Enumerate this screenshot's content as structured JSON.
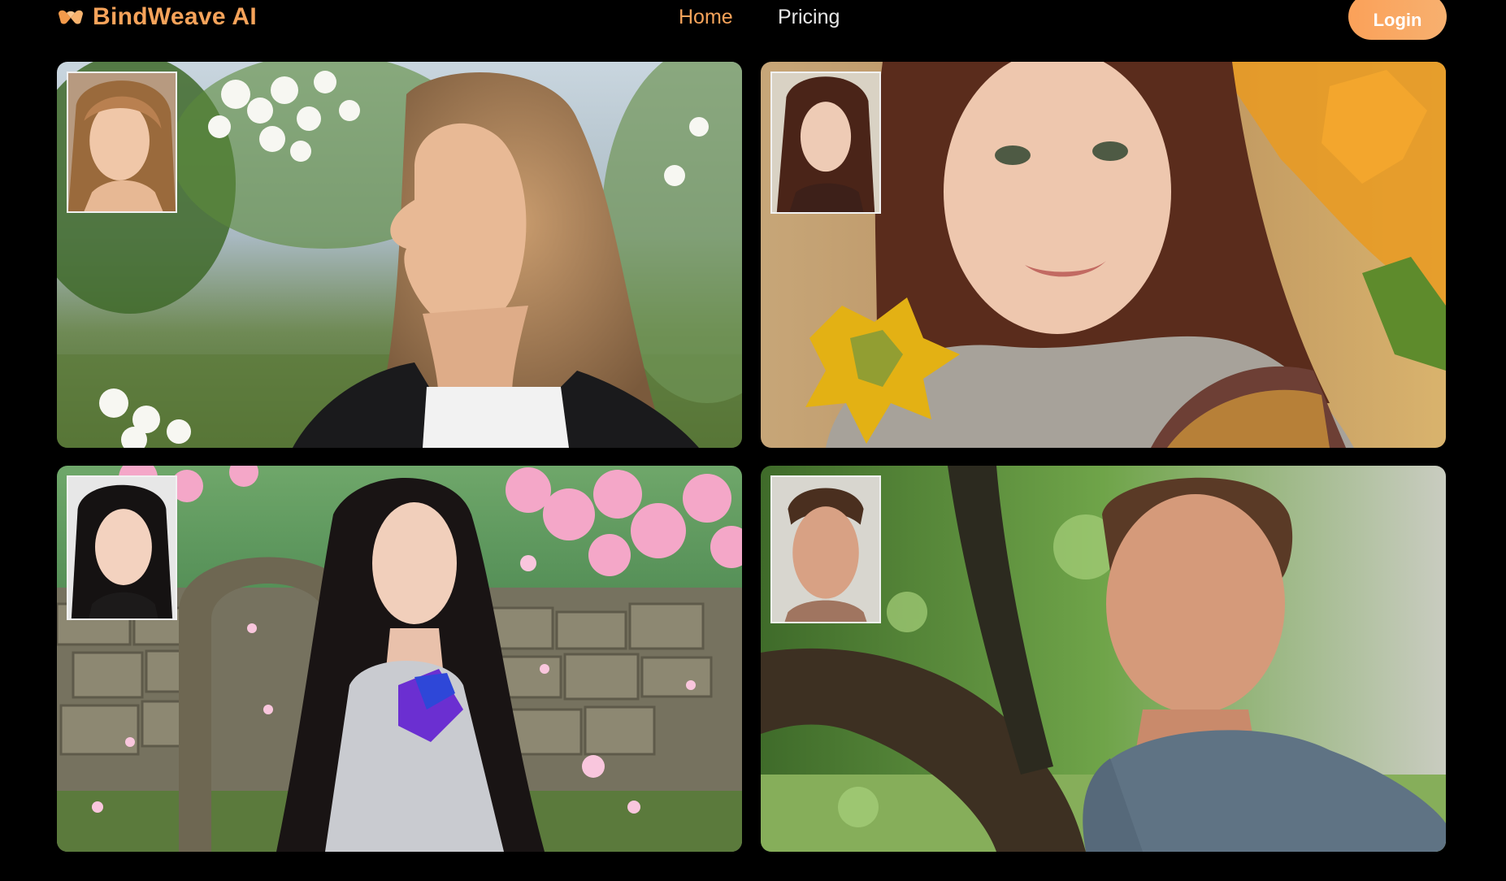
{
  "brand": {
    "name": "BindWeave AI",
    "logo_icon": "heart-logo-icon",
    "color": "#f6a35a"
  },
  "nav": {
    "home": "Home",
    "pricing": "Pricing",
    "active": "Home"
  },
  "login": {
    "label": "Login"
  },
  "accent": "#f6a35a",
  "gallery": [
    {
      "scene": "woman-profile-white-blossoms",
      "reference": "reference-face-blonde-woman"
    },
    {
      "scene": "woman-autumn-maple-leaves",
      "reference": "reference-face-brunette-woman"
    },
    {
      "scene": "woman-armor-cherry-blossoms",
      "reference": "reference-face-dark-haired-woman"
    },
    {
      "scene": "man-under-tree-blue-sweater",
      "reference": "reference-face-man"
    }
  ]
}
